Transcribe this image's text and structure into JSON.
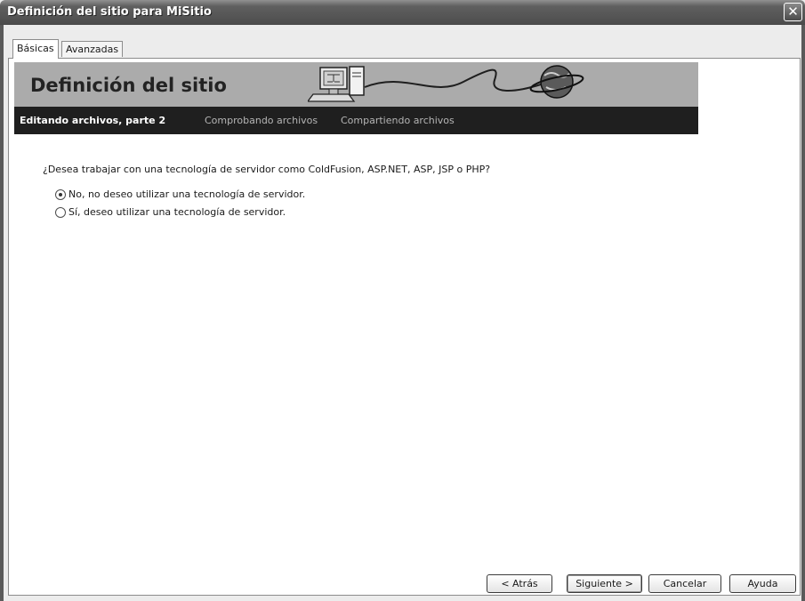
{
  "window": {
    "title": "Definición del sitio para MiSitio",
    "close_glyph": "✕"
  },
  "tabs": [
    {
      "label": "Básicas",
      "active": true
    },
    {
      "label": "Avanzadas",
      "active": false
    }
  ],
  "banner": {
    "title": "Definición del sitio",
    "icons": [
      "computer-icon",
      "globe-icon"
    ]
  },
  "steps": [
    {
      "label": "Editando archivos, parte 2",
      "current": true
    },
    {
      "label": "Comprobando archivos",
      "current": false
    },
    {
      "label": "Compartiendo archivos",
      "current": false
    }
  ],
  "question": "¿Desea trabajar con una tecnología de servidor como ColdFusion, ASP.NET, ASP, JSP o PHP?",
  "options": [
    {
      "label": "No, no deseo utilizar una tecnología de servidor.",
      "selected": true
    },
    {
      "label": "Sí, deseo utilizar una tecnología de servidor.",
      "selected": false
    }
  ],
  "buttons": {
    "back": "< Atrás",
    "next": "Siguiente >",
    "cancel": "Cancelar",
    "help": "Ayuda"
  }
}
